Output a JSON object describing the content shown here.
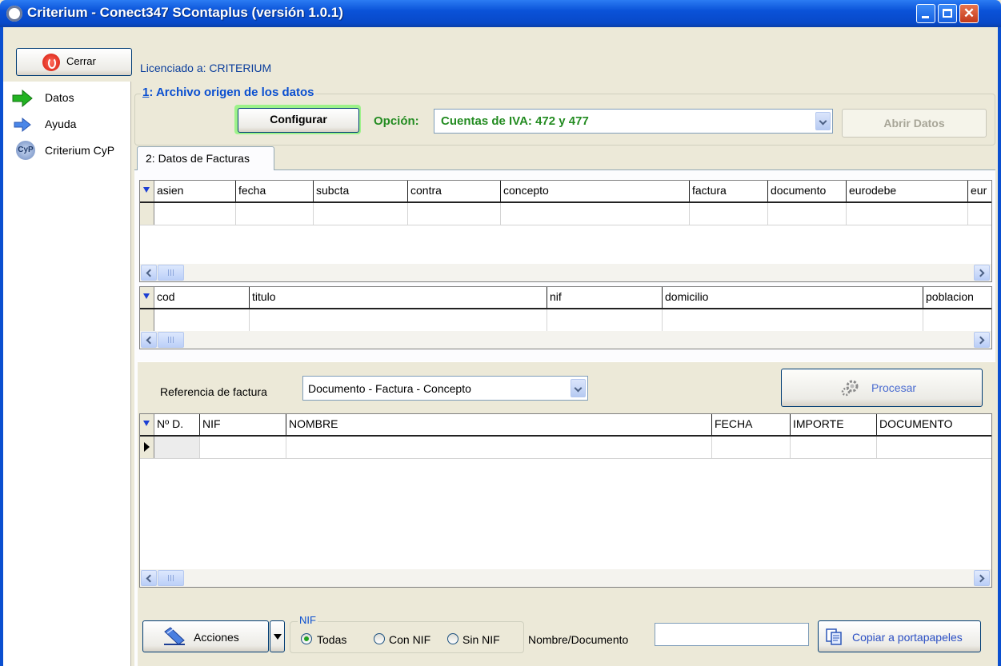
{
  "window": {
    "title": "Criterium - Conect347 SContaplus (versión 1.0.1)"
  },
  "toolbar": {
    "cerrar_label": "Cerrar",
    "licenciado": "Licenciado a: CRITERIUM"
  },
  "sidebar": {
    "items": [
      {
        "label": "Datos",
        "icon": "green-arrow-icon"
      },
      {
        "label": "Ayuda",
        "icon": "blue-arrow-icon"
      },
      {
        "label": "Criterium CyP",
        "icon": "criterium-cyp-logo-icon"
      }
    ]
  },
  "origin": {
    "title_number": "1",
    "title_rest": ": Archivo origen de los datos",
    "configurar_label": "Configurar",
    "opcion_label": "Opción:",
    "opcion_value": "Cuentas de IVA: 472 y 477",
    "abrir_label": "Abrir Datos"
  },
  "tabs": [
    {
      "label": "2: Datos de Facturas"
    }
  ],
  "grid1": {
    "columns": [
      "asien",
      "fecha",
      "subcta",
      "contra",
      "concepto",
      "factura",
      "documento",
      "eurodebe",
      "eur"
    ]
  },
  "grid2": {
    "columns": [
      "cod",
      "titulo",
      "nif",
      "domicilio",
      "poblacion"
    ]
  },
  "referencia": {
    "label": "Referencia de factura",
    "value": "Documento - Factura - Concepto"
  },
  "procesar_label": "Procesar",
  "grid3": {
    "columns": [
      "Nº D.",
      "NIF",
      "NOMBRE",
      "FECHA",
      "IMPORTE",
      "DOCUMENTO"
    ]
  },
  "bottom": {
    "acciones_label": "Acciones",
    "nif_legend": "NIF",
    "radios": [
      {
        "label": "Todas",
        "checked": true
      },
      {
        "label": "Con NIF",
        "checked": false
      },
      {
        "label": "Sin NIF",
        "checked": false
      }
    ],
    "nombre_label": "Nombre/Documento",
    "nombre_value": "",
    "copiar_label": "Copiar a portapapeles"
  },
  "colors": {
    "title_blue": "#0a52d8",
    "accent_green": "#248c22",
    "group_title_blue": "#0a4fd0",
    "highlight_green": "#9df28a"
  }
}
